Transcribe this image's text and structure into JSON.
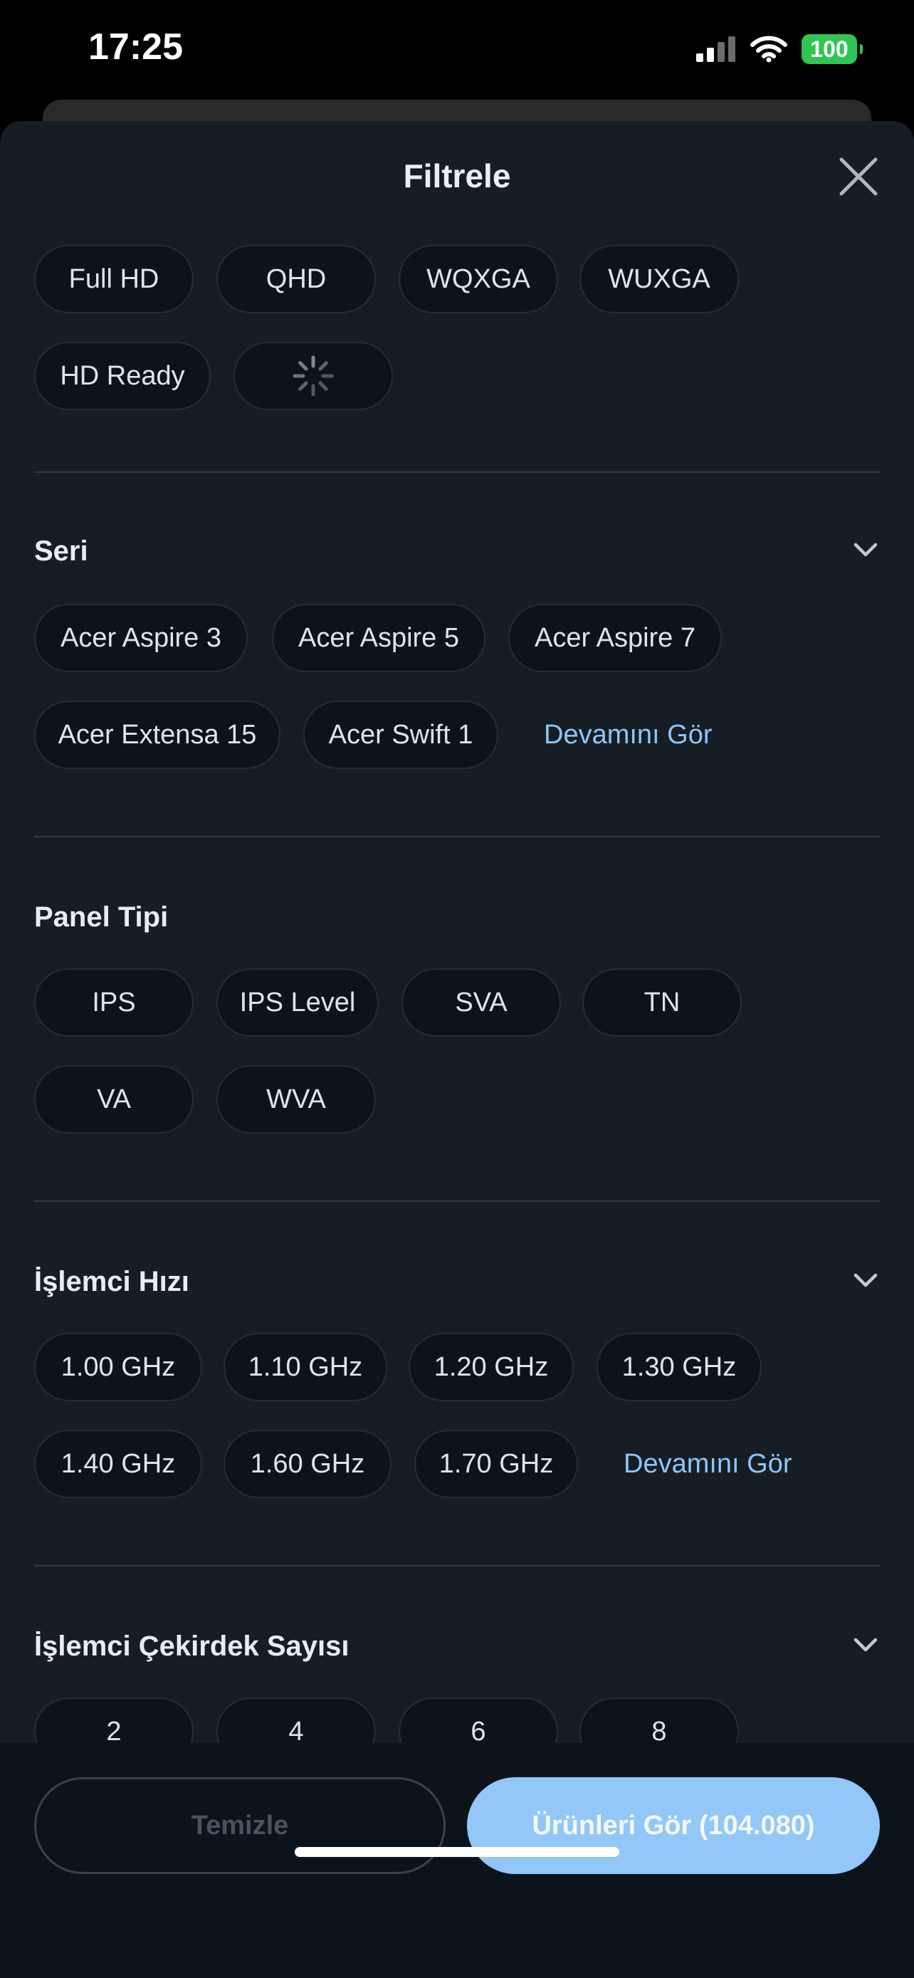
{
  "status": {
    "time": "17:25",
    "battery": "100"
  },
  "header": {
    "title": "Filtrele"
  },
  "resolution": {
    "chips": [
      "Full HD",
      "QHD",
      "WQXGA",
      "WUXGA",
      "HD Ready"
    ]
  },
  "seri": {
    "title": "Seri",
    "chips": [
      "Acer Aspire 3",
      "Acer Aspire 5",
      "Acer Aspire 7",
      "Acer Extensa 15",
      "Acer Swift 1"
    ],
    "more": "Devamını Gör"
  },
  "panel": {
    "title": "Panel Tipi",
    "chips": [
      "IPS",
      "IPS Level",
      "SVA",
      "TN",
      "VA",
      "WVA"
    ]
  },
  "cpu_speed": {
    "title": "İşlemci Hızı",
    "chips": [
      "1.00 GHz",
      "1.10 GHz",
      "1.20 GHz",
      "1.30 GHz",
      "1.40 GHz",
      "1.60 GHz",
      "1.70 GHz"
    ],
    "more": "Devamını Gör"
  },
  "cpu_cores": {
    "title": "İşlemci Çekirdek Sayısı",
    "chips": [
      "2",
      "4",
      "6",
      "8"
    ]
  },
  "footer": {
    "clear": "Temizle",
    "show": "Ürünleri Gör (104.080)"
  },
  "colors": {
    "accent": "#92c7f7",
    "sheet_bg": "#161d25",
    "chip_bg": "#0c141b"
  }
}
